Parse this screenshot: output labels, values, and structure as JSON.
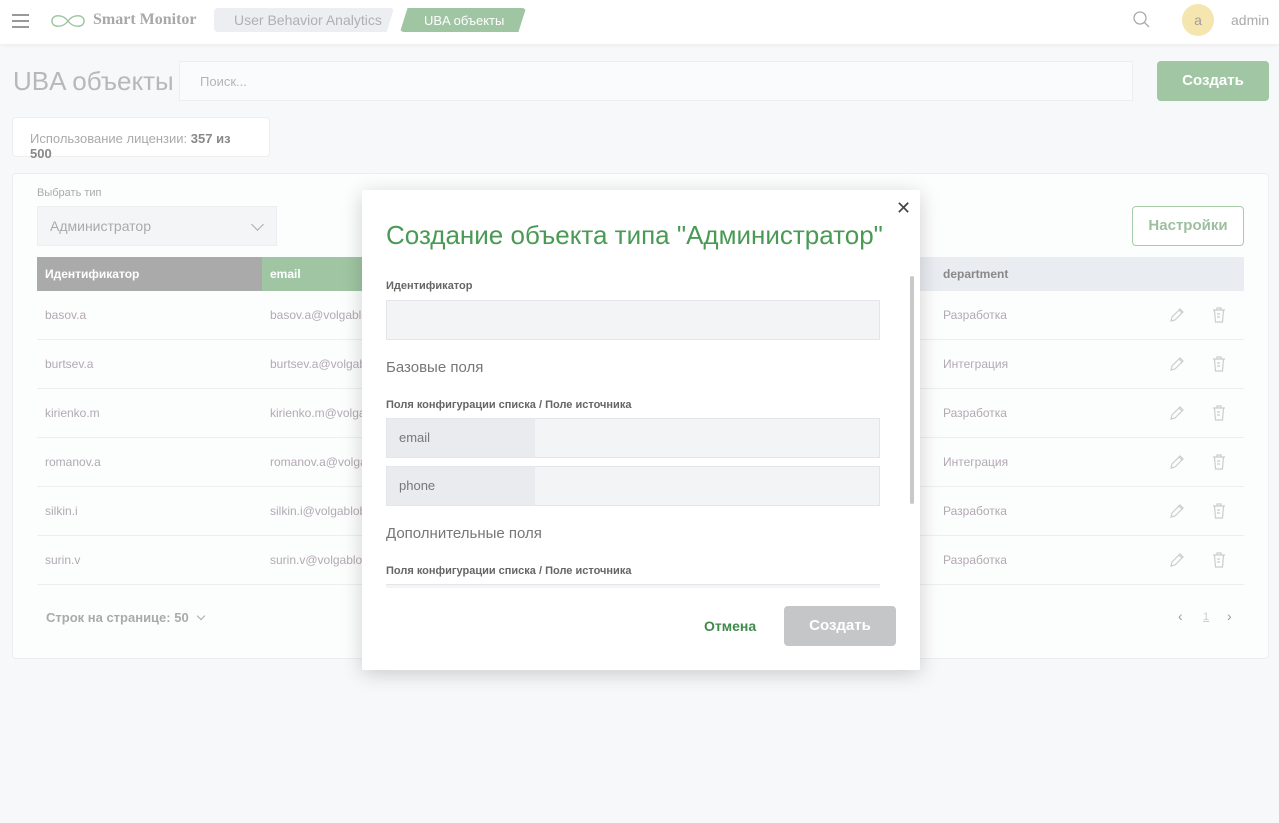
{
  "header": {
    "app_name": "Smart Monitor",
    "breadcrumbs": [
      "User Behavior Analytics",
      "UBA объекты"
    ],
    "avatar_letter": "a",
    "username": "admin"
  },
  "page": {
    "title": "UBA объекты",
    "search_placeholder": "Поиск...",
    "create_label": "Создать",
    "license_label": "Использование лицензии:",
    "license_value": "357 из 500"
  },
  "filter": {
    "label": "Выбрать тип",
    "selected": "Администратор",
    "settings_label": "Настройки"
  },
  "table": {
    "columns": [
      "Идентификатор",
      "email",
      "department"
    ],
    "rows": [
      {
        "id": "basov.a",
        "email": "basov.a@volgablo",
        "department": "Разработка"
      },
      {
        "id": "burtsev.a",
        "email": "burtsev.a@volgab",
        "department": "Интеграция"
      },
      {
        "id": "kirienko.m",
        "email": "kirienko.m@volga",
        "department": "Разработка"
      },
      {
        "id": "romanov.a",
        "email": "romanov.a@volga",
        "department": "Интеграция"
      },
      {
        "id": "silkin.i",
        "email": "silkin.i@volgablob",
        "department": "Разработка"
      },
      {
        "id": "surin.v",
        "email": "surin.v@volgablob",
        "department": "Разработка"
      }
    ],
    "rows_per_page": "Строк на странице: 50",
    "page": "1"
  },
  "modal": {
    "title": "Создание объекта типа \"Администратор\"",
    "id_label": "Идентификатор",
    "base_section": "Базовые поля",
    "config_label": "Поля конфигурации списка / Поле источника",
    "base_fields": [
      "email",
      "phone"
    ],
    "extra_section": "Дополнительные поля",
    "extra_config_label": "Поля конфигурации списка / Поле источника",
    "cancel_label": "Отмена",
    "create_label": "Создать"
  },
  "colors": {
    "accent": "#9fc5a2",
    "title_green": "#4a9a55",
    "header_id": "#aaaaaa"
  }
}
